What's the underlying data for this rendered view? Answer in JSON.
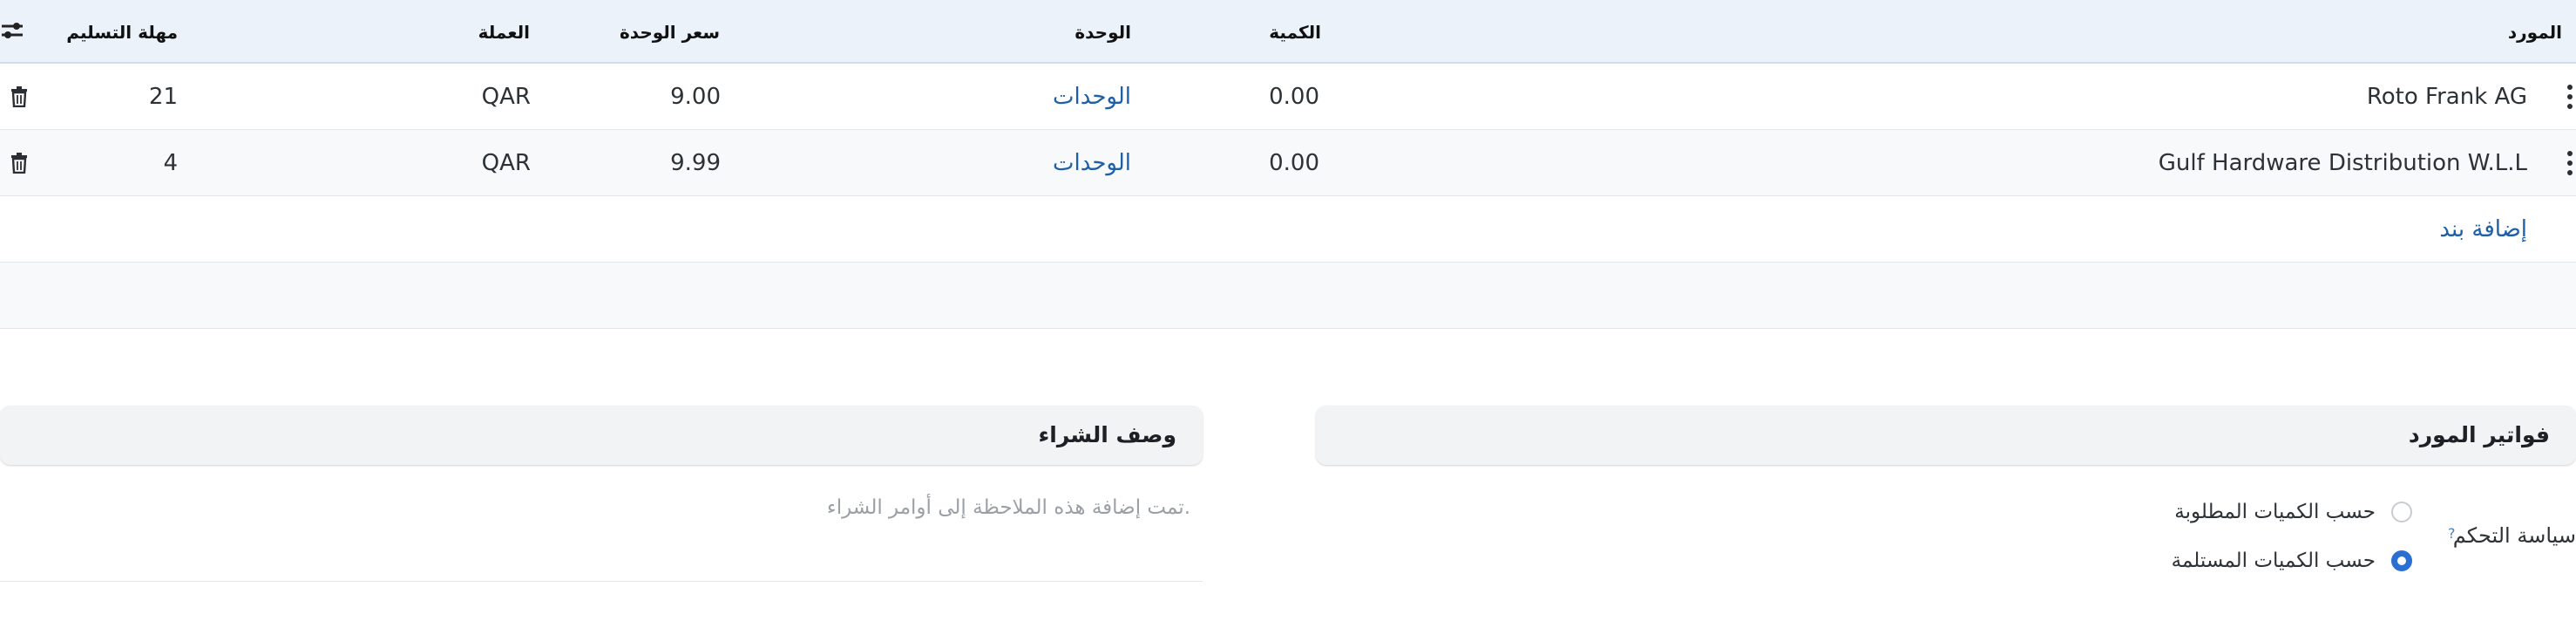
{
  "table": {
    "headers": {
      "supplier": "المورد",
      "quantity": "الكمية",
      "unit": "الوحدة",
      "unit_price": "سعر الوحدة",
      "currency": "العملة",
      "lead_time": "مهلة التسليم"
    },
    "rows": [
      {
        "supplier": "Roto Frank AG",
        "quantity": "0.00",
        "unit": "الوحدات",
        "unit_price": "9.00",
        "currency": "QAR",
        "lead_time": "21"
      },
      {
        "supplier": "Gulf Hardware Distribution W.L.L",
        "quantity": "0.00",
        "unit": "الوحدات",
        "unit_price": "9.99",
        "currency": "QAR",
        "lead_time": "4"
      }
    ],
    "add_line_label": "إضافة بند"
  },
  "vendor_bills": {
    "title": "فواتير المورد",
    "control_policy_label": "سياسة التحكم",
    "help_mark": "?",
    "options": [
      {
        "label": "حسب الكميات المطلوبة",
        "selected": false
      },
      {
        "label": "حسب الكميات المستلمة",
        "selected": true
      }
    ]
  },
  "purchase_description": {
    "title": "وصف الشراء",
    "placeholder": "تمت إضافة هذه الملاحظة إلى أوامر الشراء."
  },
  "colors": {
    "header_bg": "#ecf2fa",
    "link": "#1f5fa8",
    "radio_selected": "#2b6fd3"
  },
  "icons": [
    "kebab-menu-icon",
    "trash-icon",
    "column-settings-icon"
  ]
}
